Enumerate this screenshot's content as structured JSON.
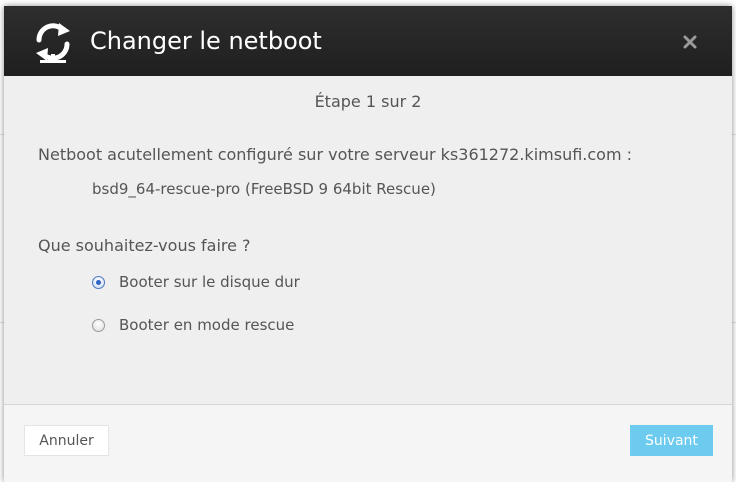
{
  "modal": {
    "title": "Changer le netboot",
    "header_icon": "netboot-sync-icon",
    "close_icon": "close-icon",
    "step": "Étape 1 sur 2",
    "current_label": "Netboot acutellement configuré sur votre serveur ks361272.kimsufi.com :",
    "current_value": "bsd9_64-rescue-pro (FreeBSD 9 64bit Rescue)",
    "question": "Que souhaitez-vous faire ?",
    "options": [
      {
        "label": "Booter sur le disque dur",
        "checked": true
      },
      {
        "label": "Booter en mode rescue",
        "checked": false
      }
    ]
  },
  "footer": {
    "cancel_label": "Annuler",
    "next_label": "Suivant"
  },
  "colors": {
    "header_bg": "#262626",
    "body_bg": "#efefef",
    "next_button": "#6ccbef",
    "text": "#555555"
  }
}
